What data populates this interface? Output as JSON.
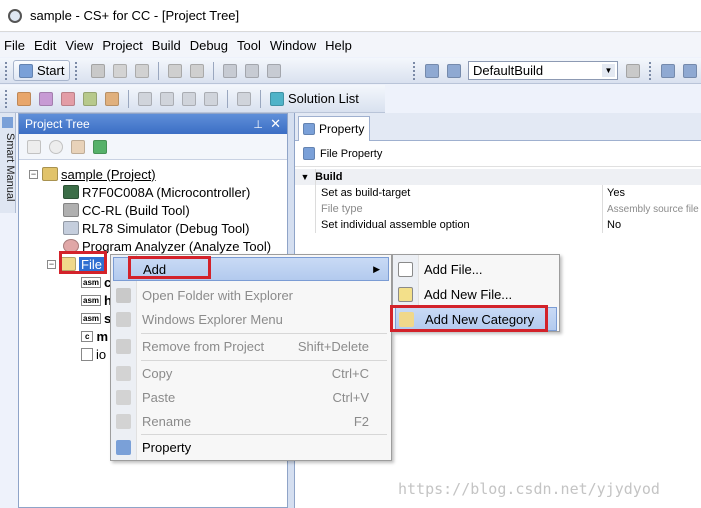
{
  "window": {
    "title": "sample - CS+ for CC - [Project Tree]"
  },
  "menu": [
    "File",
    "Edit",
    "View",
    "Project",
    "Build",
    "Debug",
    "Tool",
    "Window",
    "Help"
  ],
  "toolbar": {
    "start_label": "Start",
    "build_config": "DefaultBuild",
    "solution_list": "Solution List"
  },
  "side_tab": {
    "label": "Smart Manual"
  },
  "project_tree": {
    "title": "Project Tree",
    "items": [
      {
        "label": "sample (Project)"
      },
      {
        "label": "R7F0C008A (Microcontroller)"
      },
      {
        "label": "CC-RL (Build Tool)"
      },
      {
        "label": "RL78 Simulator (Debug Tool)"
      },
      {
        "label": "Program Analyzer (Analyze Tool)"
      },
      {
        "label": "File"
      }
    ],
    "file_children": [
      {
        "badge": "asm",
        "label": "c"
      },
      {
        "badge": "asm",
        "label": "h"
      },
      {
        "badge": "asm",
        "label": "s"
      },
      {
        "badge": "c",
        "label": "m"
      },
      {
        "badge": "",
        "label": "io"
      }
    ]
  },
  "property": {
    "tab_label": "Property",
    "header": "File Property",
    "section": "Build",
    "rows": [
      {
        "name": "Set as build-target",
        "value": "Yes",
        "disabled": false
      },
      {
        "name": "File type",
        "value": "Assembly source file",
        "disabled": true
      },
      {
        "name": "Set individual assemble option",
        "value": "No",
        "disabled": false
      }
    ]
  },
  "context_menu": {
    "items": [
      {
        "label": "Add",
        "shortcut": "",
        "disabled": false
      },
      {
        "label": "Open Folder with Explorer",
        "shortcut": "",
        "disabled": true
      },
      {
        "label": "Windows Explorer Menu",
        "shortcut": "",
        "disabled": true
      },
      {
        "label": "Remove from Project",
        "shortcut": "Shift+Delete",
        "disabled": true
      },
      {
        "label": "Copy",
        "shortcut": "Ctrl+C",
        "disabled": true
      },
      {
        "label": "Paste",
        "shortcut": "Ctrl+V",
        "disabled": true
      },
      {
        "label": "Rename",
        "shortcut": "F2",
        "disabled": true
      },
      {
        "label": "Property",
        "shortcut": "",
        "disabled": false
      }
    ]
  },
  "submenu": {
    "items": [
      {
        "label": "Add File..."
      },
      {
        "label": "Add New File..."
      },
      {
        "label": "Add New Category"
      }
    ]
  },
  "watermark": "https://blog.csdn.net/yjydyod",
  "colors": {
    "accent_blue": "#3b6ec5",
    "highlight_red": "#d3222a"
  }
}
